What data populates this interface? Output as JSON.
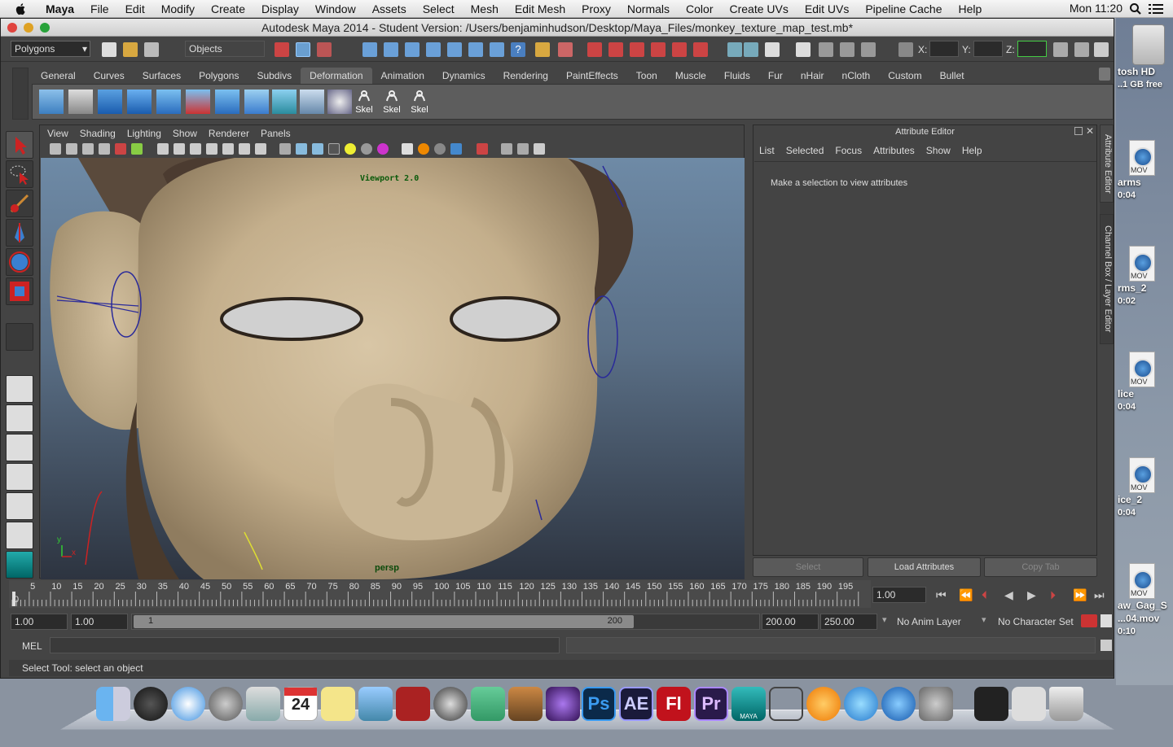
{
  "menubar": {
    "app": "Maya",
    "items": [
      "File",
      "Edit",
      "Modify",
      "Create",
      "Display",
      "Window",
      "Assets",
      "Select",
      "Mesh",
      "Edit Mesh",
      "Proxy",
      "Normals",
      "Color",
      "Create UVs",
      "Edit UVs",
      "Pipeline Cache",
      "Help"
    ],
    "clock": "Mon 11:20"
  },
  "window": {
    "title": "Autodesk Maya 2014 - Student Version: /Users/benjaminhudson/Desktop/Maya_Files/monkey_texture_map_test.mb*"
  },
  "toolbar": {
    "mode": "Polygons",
    "selection_mode": "Objects",
    "x_label": "X:",
    "y_label": "Y:",
    "z_label": "Z:"
  },
  "shelf": {
    "tabs": [
      "General",
      "Curves",
      "Surfaces",
      "Polygons",
      "Subdivs",
      "Deformation",
      "Animation",
      "Dynamics",
      "Rendering",
      "PaintEffects",
      "Toon",
      "Muscle",
      "Fluids",
      "Fur",
      "nHair",
      "nCloth",
      "Custom",
      "Bullet"
    ],
    "active_tab": "Deformation",
    "skel_labels": [
      "Skel",
      "Skel",
      "Skel"
    ]
  },
  "viewport": {
    "menu": [
      "View",
      "Shading",
      "Lighting",
      "Show",
      "Renderer",
      "Panels"
    ],
    "renderer_label": "Viewport 2.0",
    "camera_label": "persp",
    "axis_y": "y",
    "axis_x": "x"
  },
  "attribute_editor": {
    "title": "Attribute Editor",
    "menu": [
      "List",
      "Selected",
      "Focus",
      "Attributes",
      "Show",
      "Help"
    ],
    "message": "Make a selection to view attributes",
    "buttons": {
      "select": "Select",
      "load": "Load Attributes",
      "copy": "Copy Tab"
    },
    "side_tabs": [
      "Attribute Editor",
      "Channel Box / Layer Editor"
    ]
  },
  "timeline": {
    "ticks": [
      "5",
      "10",
      "15",
      "20",
      "25",
      "30",
      "35",
      "40",
      "45",
      "50",
      "55",
      "60",
      "65",
      "70",
      "75",
      "80",
      "85",
      "90",
      "95",
      "100",
      "105",
      "110",
      "115",
      "120",
      "125",
      "130",
      "135",
      "140",
      "145",
      "150",
      "155",
      "160",
      "165",
      "170",
      "175",
      "180",
      "185",
      "190",
      "195"
    ],
    "start_label": "0",
    "current_frame": "1.00"
  },
  "range": {
    "start": "1.00",
    "playback_start": "1.00",
    "slider_start": "1",
    "slider_end": "200",
    "playback_end": "200.00",
    "end": "250.00",
    "anim_layer": "No Anim Layer",
    "char_set": "No Character Set"
  },
  "command": {
    "label": "MEL"
  },
  "help_line": "Select Tool: select an object",
  "desktop": {
    "hd_label": "tosh HD",
    "hd_free": "..1 GB free",
    "files": [
      {
        "name": "arms",
        "dur": "0:04"
      },
      {
        "name": "rms_2",
        "dur": "0:02"
      },
      {
        "name": "lice",
        "dur": "0:04"
      },
      {
        "name": "ice_2",
        "dur": "0:04"
      },
      {
        "name": "aw_Gag_S",
        "name2": "...04.mov",
        "dur": "0:10"
      }
    ],
    "mov_tag": "MOV"
  },
  "dock": {
    "calendar_day": "24",
    "apps": [
      "Finder",
      "Dashboard",
      "Safari",
      "Launchpad",
      "Preview",
      "Calendar",
      "Stickies",
      "Photo Booth",
      "Photo Album",
      "iMovie",
      "GarageBand",
      "Photoshop",
      "After Effects",
      "Flash",
      "Premiere",
      "Maya",
      "Motion",
      "iBooks",
      "iTunes",
      "App Store",
      "System Preferences",
      "iTunes Music",
      "Screenshot",
      "Trash"
    ],
    "ps": "Ps",
    "ae": "AE",
    "fl": "Fl",
    "pr": "Pr",
    "maya": "MAYA"
  },
  "colors": {
    "maya_bg": "#444444",
    "skin": "#c9b595",
    "active_tab": "#5d5d5d"
  }
}
